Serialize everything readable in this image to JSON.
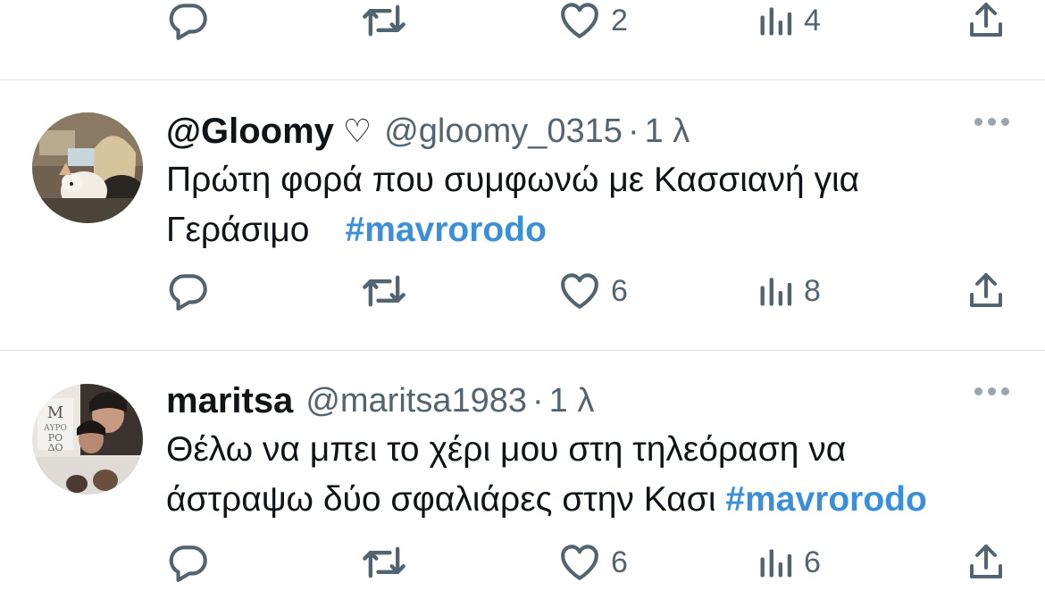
{
  "top_actions": {
    "likes": "2",
    "views": "4"
  },
  "tweets": [
    {
      "display_name": "@Gloomy",
      "badge": "♡",
      "handle": "@gloomy_0315",
      "separator": "·",
      "time": "1 λ",
      "text_line1": "Πρώτη φορά που συμφωνώ με Κασσιανή για",
      "text_line2": "Γεράσιμο",
      "hashtag": "#mavrorodo",
      "likes": "6",
      "views": "8"
    },
    {
      "display_name": "maritsa",
      "handle": "@maritsa1983",
      "separator": "·",
      "time": "1 λ",
      "text_line1": "Θέλω να μπει το χέρι μου στη τηλεόραση να",
      "text_line2": "άστραψω δύο σφαλιάρες στην Κασι",
      "hashtag": "#mavrorodo",
      "likes": "6",
      "views": "6"
    }
  ],
  "icons": [
    "reply-icon",
    "retweet-icon",
    "like-icon",
    "views-icon",
    "share-icon",
    "more-icon"
  ],
  "colors": {
    "text": "#0f1419",
    "secondary": "#536471",
    "hashtag": "#3b8fd8",
    "divider": "#dfe3e6"
  }
}
